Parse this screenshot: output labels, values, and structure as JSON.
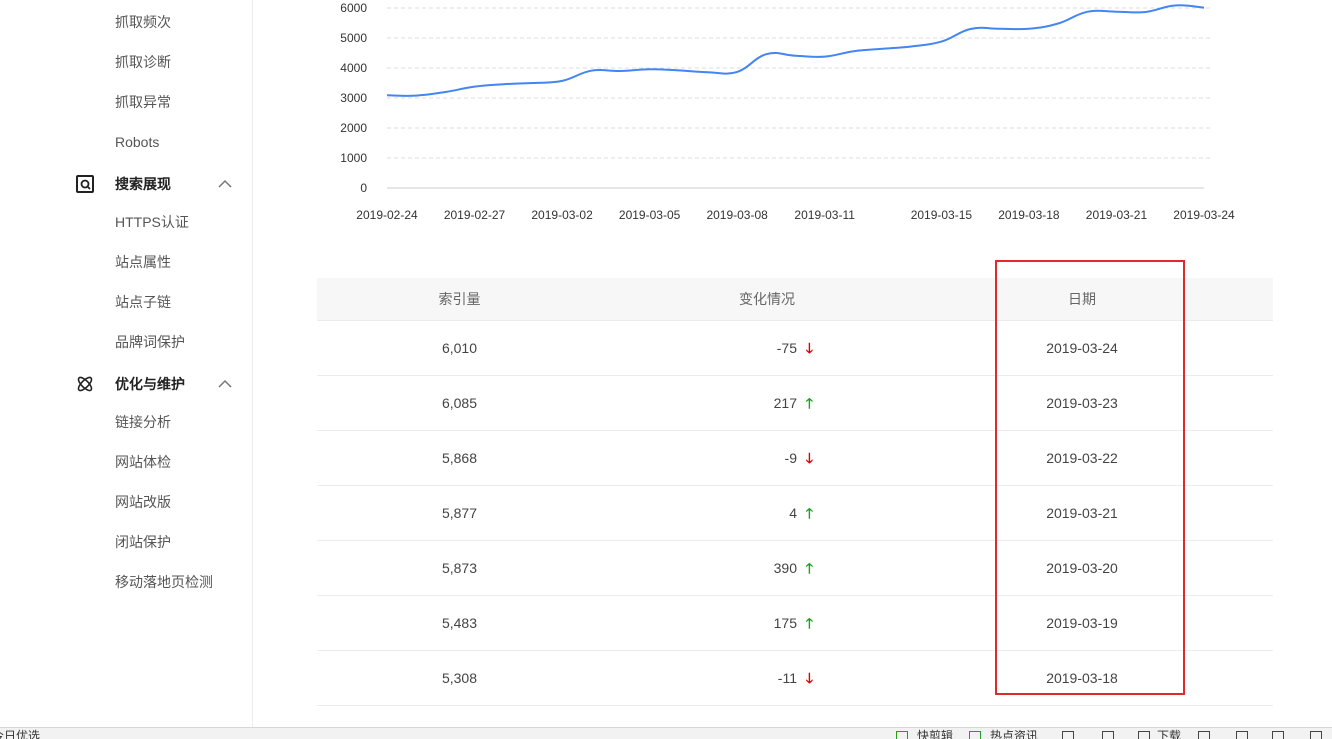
{
  "sidebar": {
    "items_top": [
      "抓取频次",
      "抓取诊断",
      "抓取异常",
      "Robots"
    ],
    "group_search": {
      "title": "搜索展现",
      "icon": "search-display-icon",
      "items": [
        "HTTPS认证",
        "站点属性",
        "站点子链",
        "品牌词保护"
      ]
    },
    "group_optimize": {
      "title": "优化与维护",
      "icon": "atom-icon",
      "items": [
        "链接分析",
        "网站体检",
        "网站改版",
        "闭站保护",
        "移动落地页检测"
      ]
    }
  },
  "chart_data": {
    "type": "line",
    "title": "",
    "xlabel": "",
    "ylabel": "",
    "ylim": [
      0,
      6000
    ],
    "yticks": [
      0,
      1000,
      2000,
      3000,
      4000,
      5000,
      6000
    ],
    "xtick_labels": [
      "2019-02-24",
      "2019-02-27",
      "2019-03-02",
      "2019-03-05",
      "2019-03-08",
      "2019-03-11",
      "2019-03-15",
      "2019-03-18",
      "2019-03-21",
      "2019-03-24"
    ],
    "grid": true,
    "color": "#4285f4",
    "x": [
      "2019-02-24",
      "2019-02-25",
      "2019-02-26",
      "2019-02-27",
      "2019-02-28",
      "2019-03-01",
      "2019-03-02",
      "2019-03-03",
      "2019-03-04",
      "2019-03-05",
      "2019-03-06",
      "2019-03-07",
      "2019-03-08",
      "2019-03-09",
      "2019-03-10",
      "2019-03-11",
      "2019-03-12",
      "2019-03-13",
      "2019-03-14",
      "2019-03-15",
      "2019-03-16",
      "2019-03-17",
      "2019-03-18",
      "2019-03-19",
      "2019-03-20",
      "2019-03-21",
      "2019-03-22",
      "2019-03-23",
      "2019-03-24"
    ],
    "values": [
      3090,
      3080,
      3200,
      3380,
      3460,
      3500,
      3570,
      3910,
      3900,
      3960,
      3920,
      3860,
      3870,
      4460,
      4410,
      4380,
      4560,
      4640,
      4720,
      4880,
      5300,
      5310,
      5308,
      5483,
      5873,
      5877,
      5868,
      6085,
      6010
    ]
  },
  "table": {
    "headers": [
      "索引量",
      "变化情况",
      "日期"
    ],
    "rows": [
      {
        "count": "6,010",
        "change": "-75",
        "dir": "down",
        "date": "2019-03-24"
      },
      {
        "count": "6,085",
        "change": "217",
        "dir": "up",
        "date": "2019-03-23"
      },
      {
        "count": "5,868",
        "change": "-9",
        "dir": "down",
        "date": "2019-03-22"
      },
      {
        "count": "5,877",
        "change": "4",
        "dir": "up",
        "date": "2019-03-21"
      },
      {
        "count": "5,873",
        "change": "390",
        "dir": "up",
        "date": "2019-03-20"
      },
      {
        "count": "5,483",
        "change": "175",
        "dir": "up",
        "date": "2019-03-19"
      },
      {
        "count": "5,308",
        "change": "-11",
        "dir": "down",
        "date": "2019-03-18"
      }
    ],
    "arrow_up": "🡑",
    "arrow_down": "🡓"
  },
  "statusbar": {
    "left_text": "今日优选",
    "items": [
      "快剪辑",
      "热点资讯",
      "下载"
    ]
  }
}
